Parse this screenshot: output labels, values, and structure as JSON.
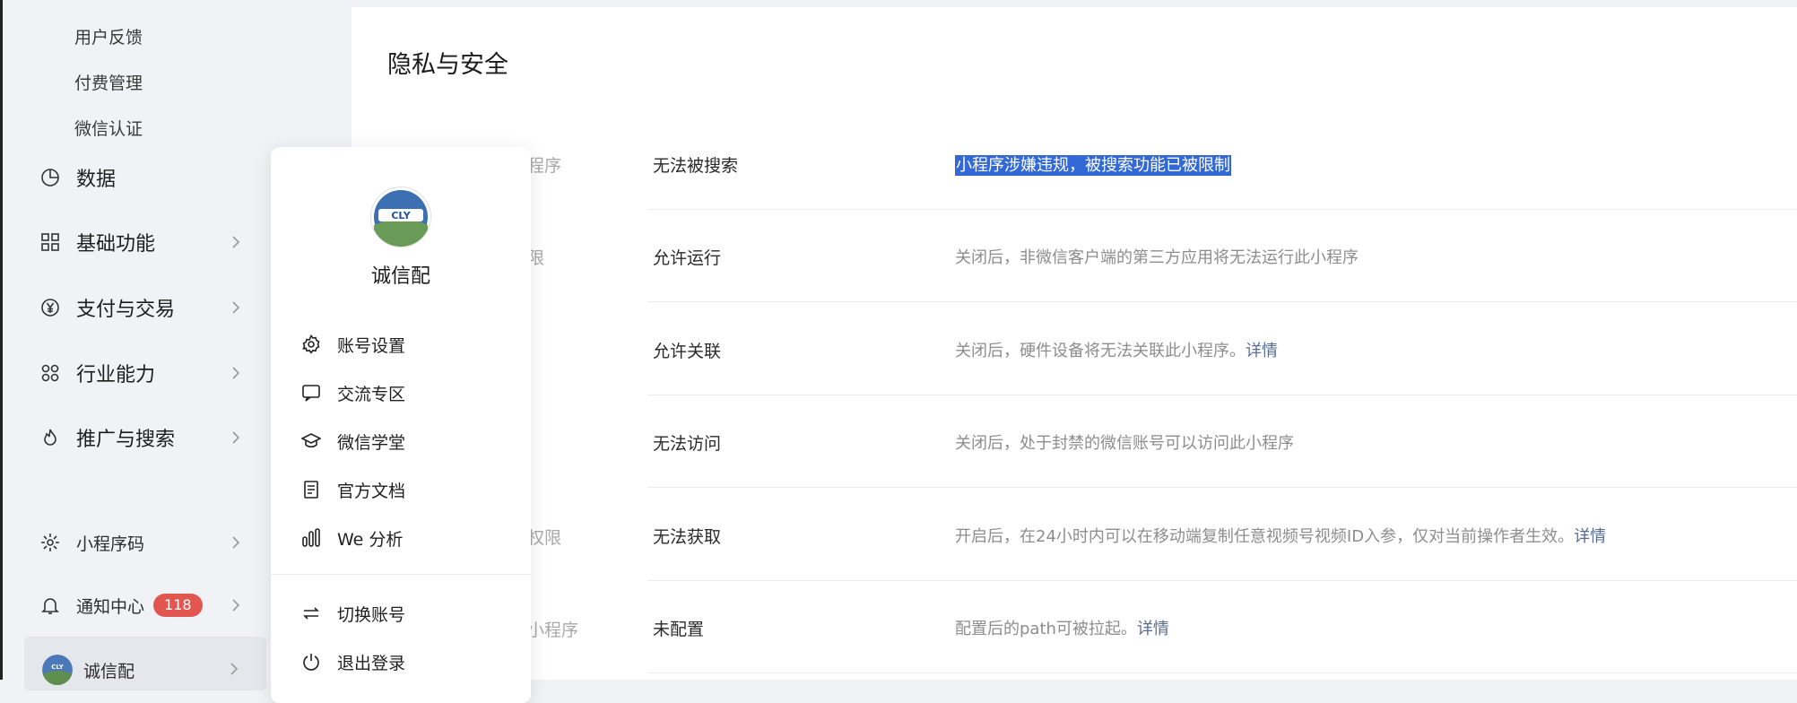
{
  "sidebar": {
    "sub_items": [
      "用户反馈",
      "付费管理",
      "微信认证"
    ],
    "nav_items": [
      {
        "label": "数据",
        "icon": "pie-chart-icon"
      },
      {
        "label": "基础功能",
        "icon": "grid-icon"
      },
      {
        "label": "支付与交易",
        "icon": "yen-icon"
      },
      {
        "label": "行业能力",
        "icon": "nodes-icon"
      },
      {
        "label": "推广与搜索",
        "icon": "flame-icon"
      }
    ],
    "bottom_items": [
      {
        "label": "小程序码",
        "icon": "miniprogram-code-icon"
      },
      {
        "label": "通知中心",
        "icon": "bell-icon",
        "badge": "118"
      }
    ],
    "account": {
      "label": "诚信配"
    }
  },
  "main": {
    "title": "隐私与安全",
    "rows": [
      {
        "label_fragment": "程序",
        "status": "无法被搜索",
        "desc": "小程序涉嫌违规，被搜索功能已被限制",
        "selected": true
      },
      {
        "label_fragment": "限",
        "status": "允许运行",
        "desc": "关闭后，非微信客户端的第三方应用将无法运行此小程序"
      },
      {
        "label_fragment": "",
        "status": "允许关联",
        "desc": "关闭后，硬件设备将无法关联此小程序。",
        "link": "详情"
      },
      {
        "label_fragment": "",
        "status": "无法访问",
        "desc": "关闭后，处于封禁的微信账号可以访问此小程序"
      },
      {
        "label_fragment": "权限",
        "status": "无法获取",
        "desc": "开启后，在24小时内可以在移动端复制任意视频号视频ID入参，仅对当前操作者生效。",
        "link": "详情"
      },
      {
        "label_fragment": "小程序",
        "status": "未配置",
        "desc": "配置后的path可被拉起。",
        "link": "详情"
      }
    ]
  },
  "popup": {
    "name": "诚信配",
    "avatar_text": "CLY",
    "menu": [
      {
        "label": "账号设置",
        "icon": "gear-icon"
      },
      {
        "label": "交流专区",
        "icon": "chat-icon"
      },
      {
        "label": "微信学堂",
        "icon": "graduation-cap-icon"
      },
      {
        "label": "官方文档",
        "icon": "document-icon"
      },
      {
        "label": "We 分析",
        "icon": "bar-chart-icon"
      }
    ],
    "menu2": [
      {
        "label": "切换账号",
        "icon": "switch-icon"
      },
      {
        "label": "退出登录",
        "icon": "power-icon"
      }
    ]
  },
  "colors": {
    "badge": "#e25650",
    "link": "#576b95",
    "selection": "#3369d6"
  }
}
